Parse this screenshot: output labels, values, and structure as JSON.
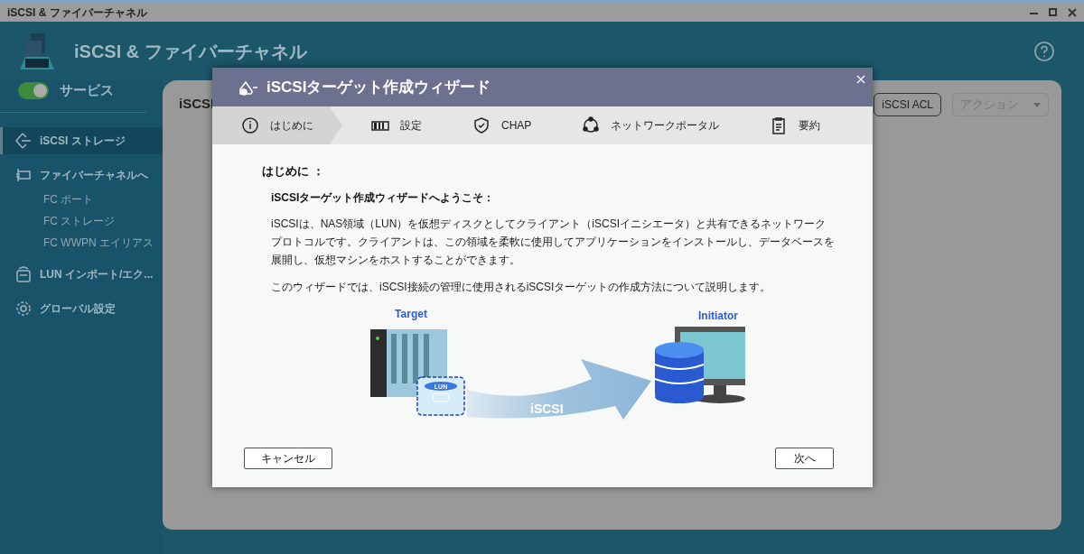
{
  "window": {
    "title": "iSCSI & ファイバーチャネル"
  },
  "app": {
    "title": "iSCSI & ファイバーチャネル"
  },
  "service": {
    "label": "サービス",
    "on": true
  },
  "sidebar": {
    "items": [
      {
        "label": "iSCSI ストレージ",
        "selected": true
      },
      {
        "label": "ファイバーチャネルへ",
        "selected": false,
        "children": [
          {
            "label": "FC ポート",
            "selected": false
          },
          {
            "label": "FC ストレージ",
            "selected": false
          },
          {
            "label": "FC WWPN エイリアス",
            "selected": false
          }
        ]
      },
      {
        "label": "LUN インポート/エク...",
        "selected": false
      },
      {
        "label": "グローバル設定",
        "selected": false
      }
    ]
  },
  "main": {
    "heading": "iSCSI",
    "buttons": [
      {
        "label": "iSCSI ACL",
        "kind": "button",
        "disabled": false
      },
      {
        "label": "アクション",
        "kind": "dropdown",
        "disabled": true
      }
    ]
  },
  "dialog": {
    "title": "iSCSIターゲット作成ウィザード",
    "steps": [
      {
        "label": "はじめに",
        "selected": true
      },
      {
        "label": "設定",
        "selected": false
      },
      {
        "label": "CHAP",
        "selected": false
      },
      {
        "label": "ネットワークポータル",
        "selected": false
      },
      {
        "label": "要約",
        "selected": false
      }
    ],
    "heading": "はじめに ：",
    "subheading": "iSCSIターゲット作成ウィザードへようこそ：",
    "paragraphs": [
      "iSCSIは、NAS領域（LUN）を仮想ディスクとしてクライアント（iSCSIイニシエータ）と共有できるネットワークプロトコルです。クライアントは、この領域を柔軟に使用してアプリケーションをインストールし、データベースを展開し、仮想マシンをホストすることができます。",
      "このウィザードでは、iSCSI接続の管理に使用されるiSCSIターゲットの作成方法について説明します。"
    ],
    "diagram": {
      "target": "Target",
      "initiator": "Initiator",
      "lun": "LUN",
      "protocol": "iSCSI"
    },
    "cancel": "キャンセル",
    "next": "次へ"
  }
}
